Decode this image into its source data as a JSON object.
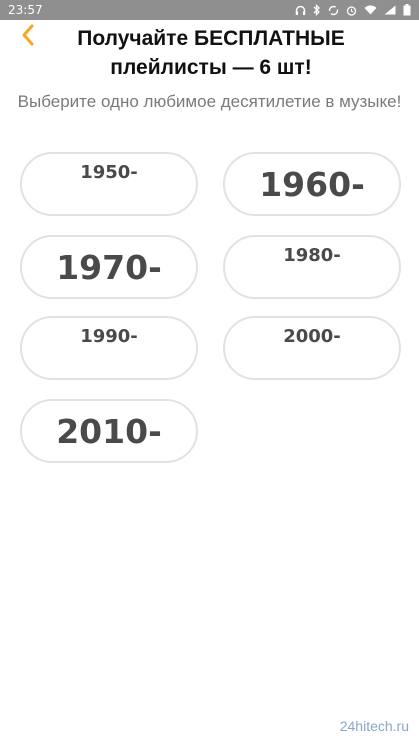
{
  "status_bar": {
    "time": "23:57",
    "icons": [
      "headphones-icon",
      "bluetooth-icon",
      "sync-icon",
      "alarm-icon",
      "wifi-icon",
      "signal-icon",
      "battery-icon"
    ]
  },
  "header": {
    "back_icon": "chevron-left-icon",
    "title": "Получайте БЕСПЛАТНЫЕ плейлисты — 6 шт!"
  },
  "subtitle": "Выберите одно любимое десятилетие в музыке!",
  "decades": [
    {
      "label": "1950-",
      "size": "small"
    },
    {
      "label": "1960-",
      "size": "big"
    },
    {
      "label": "1970-",
      "size": "big"
    },
    {
      "label": "1980-",
      "size": "small"
    },
    {
      "label": "1990-",
      "size": "small"
    },
    {
      "label": "2000-",
      "size": "small"
    },
    {
      "label": "2010-",
      "size": "big"
    }
  ],
  "colors": {
    "accent": "#f5a623",
    "status_bar": "#8f8f8f",
    "pill_border": "#e2e2e2",
    "pill_text": "#4a4a4a"
  },
  "watermark": "24hitech.ru"
}
